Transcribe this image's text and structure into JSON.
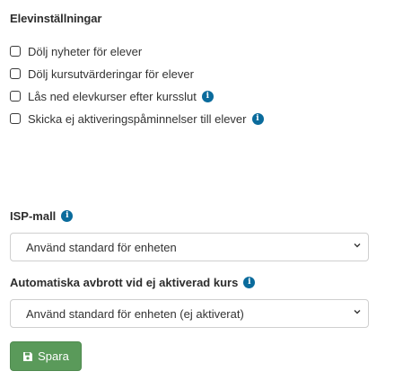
{
  "student_settings": {
    "title": "Elevinställningar",
    "options": [
      {
        "label": "Dölj nyheter för elever",
        "checked": false,
        "has_info": false
      },
      {
        "label": "Dölj kursutvärderingar för elever",
        "checked": false,
        "has_info": false
      },
      {
        "label": "Lås ned elevkurser efter kursslut",
        "checked": false,
        "has_info": true
      },
      {
        "label": "Skicka ej aktiveringspåminnelser till elever",
        "checked": false,
        "has_info": true
      }
    ]
  },
  "isp_template": {
    "label": "ISP-mall",
    "selected": "Använd standard för enheten"
  },
  "auto_abort": {
    "label": "Automatiska avbrott vid ej aktiverad kurs",
    "selected": "Använd standard för enheten (ej aktiverat)"
  },
  "save_button": {
    "label": "Spara",
    "icon": "floppy-disk-icon"
  },
  "colors": {
    "info_icon": "#0a6b9c",
    "save_button": "#5a9a5a"
  }
}
